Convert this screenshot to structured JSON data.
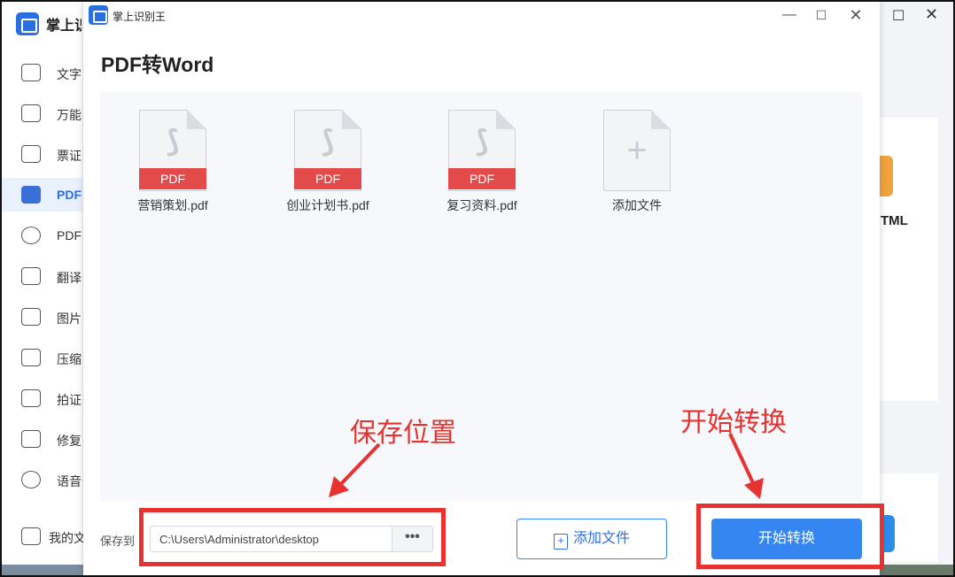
{
  "background_app": {
    "title": "掌上识别王",
    "sidebar_items": [
      {
        "label": "文字",
        "icon": "text-icon"
      },
      {
        "label": "万能",
        "icon": "scan-icon"
      },
      {
        "label": "票证",
        "icon": "ticket-icon"
      },
      {
        "label": "PDF",
        "icon": "pdf-icon",
        "active": true
      },
      {
        "label": "PDF",
        "icon": "clock-icon"
      },
      {
        "label": "翻译",
        "icon": "translate-icon"
      },
      {
        "label": "图片",
        "icon": "image-icon"
      },
      {
        "label": "压缩",
        "icon": "compress-icon"
      },
      {
        "label": "拍证",
        "icon": "id-photo-icon"
      },
      {
        "label": "修复",
        "icon": "repair-icon"
      },
      {
        "label": "语音",
        "icon": "voice-icon"
      }
    ],
    "my_files_label": "我的文",
    "html_card_label": "TML"
  },
  "dialog": {
    "app_title": "掌上识别王",
    "heading": "PDF转Word",
    "files": [
      {
        "badge": "PDF",
        "name": "营销策划.pdf"
      },
      {
        "badge": "PDF",
        "name": "创业计划书.pdf"
      },
      {
        "badge": "PDF",
        "name": "复习资料.pdf"
      }
    ],
    "add_file_tile_label": "添加文件",
    "save_to_label": "保存到",
    "save_path": "C:\\Users\\Administrator\\desktop",
    "more_label": "•••",
    "add_file_button": "添加文件",
    "start_button": "开始转换"
  },
  "annotations": {
    "save_location": "保存位置",
    "start_convert": "开始转换"
  },
  "colors": {
    "accent": "#3586f0",
    "annotation_red": "#e8322f",
    "pdf_red": "#e34a4a"
  }
}
